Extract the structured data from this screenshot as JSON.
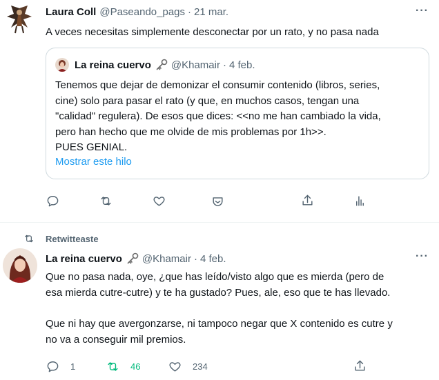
{
  "tweet1": {
    "author_name": "Laura Coll",
    "author_handle": "@Paseando_pags",
    "date": "21 mar.",
    "text": "A veces necesitas simplemente desconectar por un rato, y no pasa nada",
    "avatar_icon": "fairy-avatar",
    "quoted": {
      "author_name": "La reina cuervo",
      "author_handle": "@Khamair",
      "date": "4 feb.",
      "emoji_icon": "key-icon",
      "lines": [
        "Tenemos que dejar de demonizar el consumir contenido (libros, series,",
        "cine) solo para pasar el rato (y que, en muchos casos, tengan una",
        "\"calidad\" regulera). De esos que dices: <<no me han cambiado la vida,",
        "pero han hecho que me olvide de mis problemas por 1h>>.",
        "PUES GENIAL."
      ],
      "show_thread_label": "Mostrar este hilo"
    }
  },
  "retweet_context": {
    "label": "Retwitteaste"
  },
  "tweet2": {
    "author_name": "La reina cuervo",
    "author_handle": "@Khamair",
    "date": "4 feb.",
    "emoji_icon": "key-icon",
    "paragraph1_lines": [
      "Que no pasa nada, oye, ¿que has leído/visto algo que es mierda (pero de",
      "esa mierda cutre-cutre) y te ha gustado? Pues, ale, eso que te has llevado."
    ],
    "paragraph2_lines": [
      "Que ni hay que avergonzarse, ni tampoco negar que X contenido es cutre y",
      "no va a conseguir mil premios."
    ],
    "reply_count": "1",
    "retweet_count": "46",
    "like_count": "234"
  },
  "colors": {
    "link": "#1d9bf0",
    "retweeted": "#00ba7c",
    "muted": "#536471",
    "border": "#cfd9de"
  }
}
